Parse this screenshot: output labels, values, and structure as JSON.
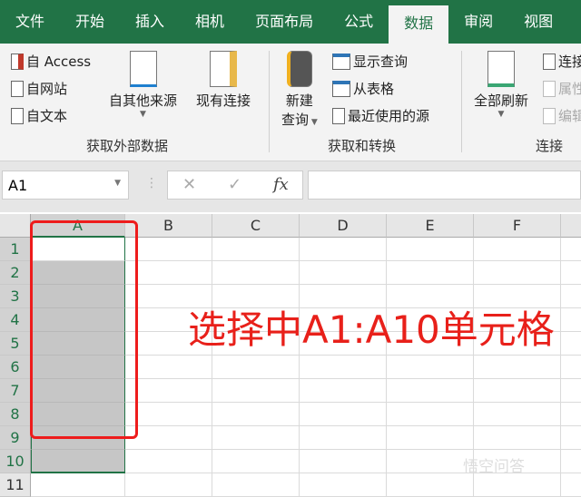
{
  "tabs": [
    "文件",
    "开始",
    "插入",
    "相机",
    "页面布局",
    "公式",
    "数据",
    "审阅",
    "视图"
  ],
  "active_tab": "数据",
  "ribbon": {
    "get_external": {
      "access": "自 Access",
      "web": "自网站",
      "text": "自文本",
      "other": "自其他来源",
      "existing": "现有连接",
      "label": "获取外部数据"
    },
    "get_transform": {
      "new_query_1": "新建",
      "new_query_2": "查询",
      "show_queries": "显示查询",
      "from_table": "从表格",
      "recent_sources": "最近使用的源",
      "label": "获取和转换"
    },
    "connections": {
      "refresh_all": "全部刷新",
      "connections": "连接",
      "properties": "属性",
      "edit_links": "编辑",
      "label": "连接"
    }
  },
  "formula_bar": {
    "name_box": "A1",
    "cancel": "✕",
    "enter": "✓",
    "fx": "fx",
    "value": ""
  },
  "columns": [
    "A",
    "B",
    "C",
    "D",
    "E",
    "F"
  ],
  "rows": [
    "1",
    "2",
    "3",
    "4",
    "5",
    "6",
    "7",
    "8",
    "9",
    "10",
    "11"
  ],
  "selection": "A1:A10",
  "annotation": "选择中A1:A10单元格",
  "watermark": "悟空问答",
  "colors": {
    "excel_green": "#217346",
    "annotation_red": "#e8201a"
  }
}
